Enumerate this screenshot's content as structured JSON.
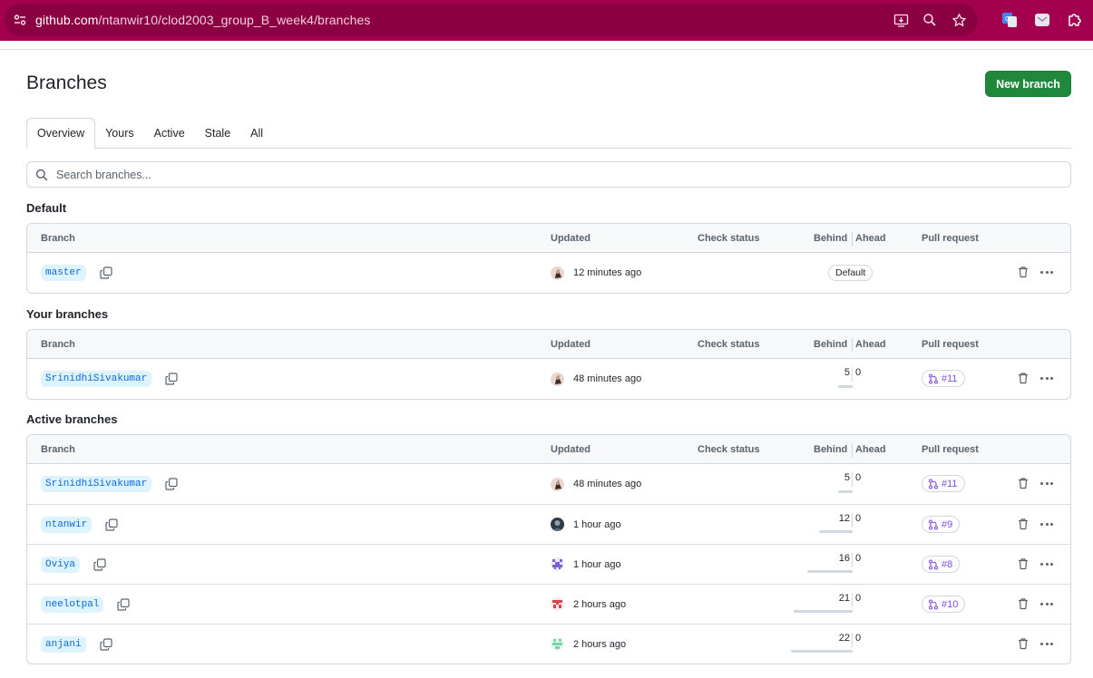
{
  "browser": {
    "url_host": "github.com",
    "url_path": "/ntanwir10/clod2003_group_B_week4/branches"
  },
  "page": {
    "title": "Branches",
    "new_branch_label": "New branch"
  },
  "tabs": [
    "Overview",
    "Yours",
    "Active",
    "Stale",
    "All"
  ],
  "search": {
    "placeholder": "Search branches..."
  },
  "columns": {
    "branch": "Branch",
    "updated": "Updated",
    "check_status": "Check status",
    "behind": "Behind",
    "ahead": "Ahead",
    "pull_request": "Pull request"
  },
  "default_section": {
    "title": "Default",
    "rows": [
      {
        "branch": "master",
        "updated": "12 minutes ago",
        "badge": "Default",
        "avatar": "avatar-a"
      }
    ]
  },
  "your_section": {
    "title": "Your branches",
    "rows": [
      {
        "branch": "SrinidhiSivakumar",
        "updated": "48 minutes ago",
        "behind": "5",
        "ahead": "0",
        "pr": "#11",
        "avatar": "avatar-a",
        "behind_fraction": 0.23
      }
    ]
  },
  "active_section": {
    "title": "Active branches",
    "rows": [
      {
        "branch": "SrinidhiSivakumar",
        "updated": "48 minutes ago",
        "behind": "5",
        "ahead": "0",
        "pr": "#11",
        "avatar": "avatar-a",
        "behind_fraction": 0.23
      },
      {
        "branch": "ntanwir",
        "updated": "1 hour ago",
        "behind": "12",
        "ahead": "0",
        "pr": "#9",
        "avatar": "avatar-b",
        "behind_fraction": 0.55
      },
      {
        "branch": "Oviya",
        "updated": "1 hour ago",
        "behind": "16",
        "ahead": "0",
        "pr": "#8",
        "avatar": "avatar-c",
        "behind_fraction": 0.73
      },
      {
        "branch": "neelotpal",
        "updated": "2 hours ago",
        "behind": "21",
        "ahead": "0",
        "pr": "#10",
        "avatar": "avatar-d",
        "behind_fraction": 0.95
      },
      {
        "branch": "anjani",
        "updated": "2 hours ago",
        "behind": "22",
        "ahead": "0",
        "pr": "",
        "avatar": "avatar-e",
        "behind_fraction": 1.0
      }
    ]
  },
  "colors": {
    "chrome": "#a3004f",
    "primary_button": "#1f883d",
    "branch_link": "#0969da",
    "pr_open": "#8250df"
  }
}
